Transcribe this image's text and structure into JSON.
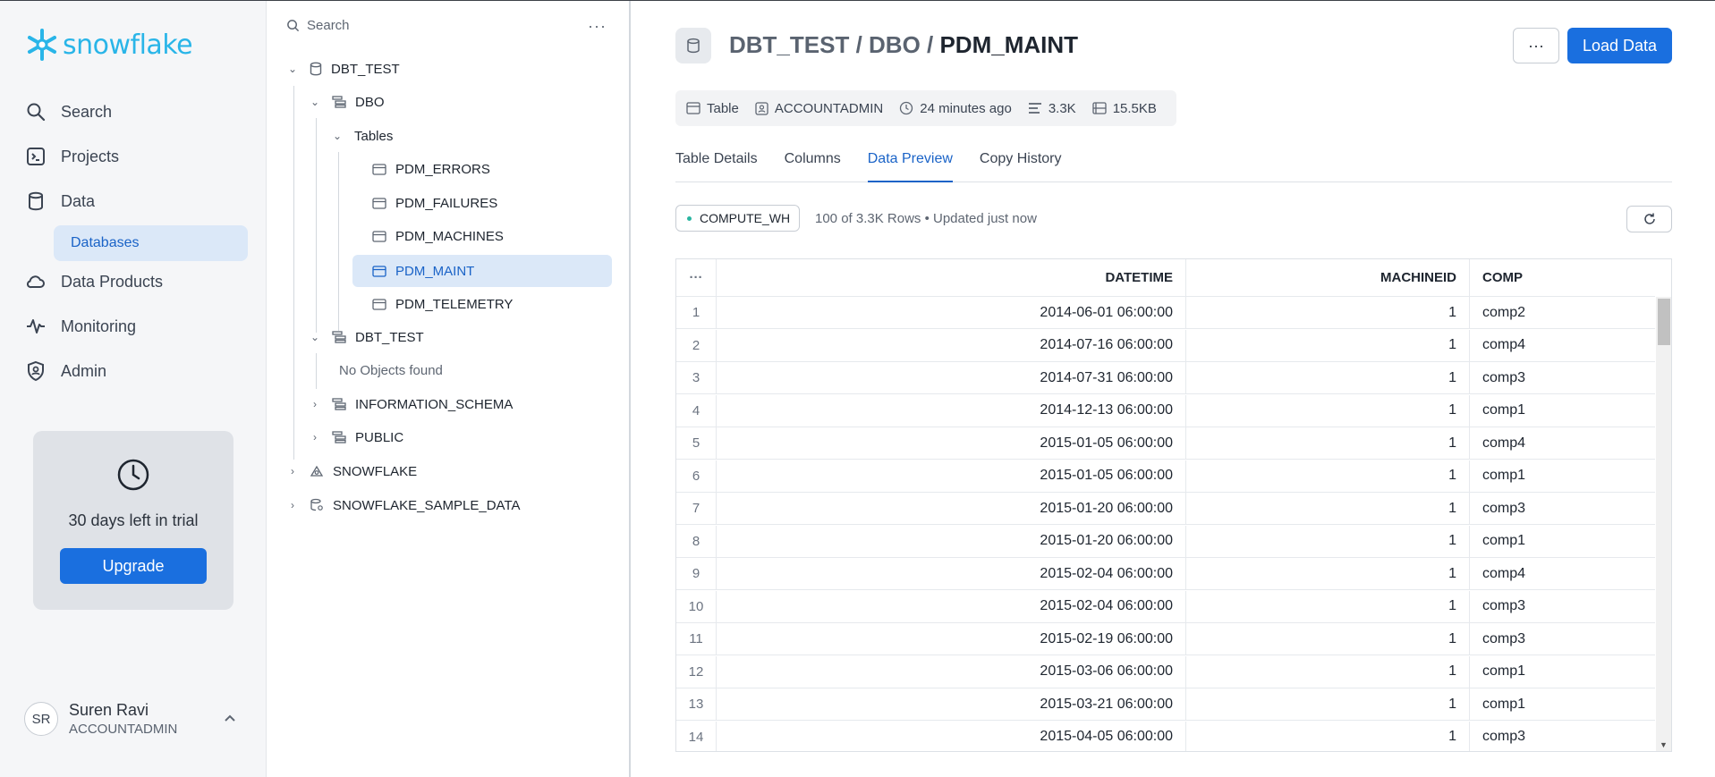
{
  "nav": {
    "logo_text": "snowflake",
    "items": [
      {
        "label": "Search",
        "icon": "search-icon"
      },
      {
        "label": "Projects",
        "icon": "terminal-icon"
      },
      {
        "label": "Data",
        "icon": "database-icon"
      },
      {
        "label": "Data Products",
        "icon": "cloud-icon"
      },
      {
        "label": "Monitoring",
        "icon": "activity-icon"
      },
      {
        "label": "Admin",
        "icon": "shield-icon"
      }
    ],
    "sub_item": "Databases",
    "trial": {
      "text": "30 days left in trial",
      "button": "Upgrade"
    },
    "user": {
      "initials": "SR",
      "name": "Suren Ravi",
      "role": "ACCOUNTADMIN"
    }
  },
  "tree": {
    "search_placeholder": "Search",
    "more": "···",
    "nodes": {
      "db1": "DBT_TEST",
      "schema_dbo": "DBO",
      "tables": "Tables",
      "t1": "PDM_ERRORS",
      "t2": "PDM_FAILURES",
      "t3": "PDM_MACHINES",
      "t4": "PDM_MAINT",
      "t5": "PDM_TELEMETRY",
      "schema_dbt": "DBT_TEST",
      "no_objects": "No Objects found",
      "schema_info": "INFORMATION_SCHEMA",
      "schema_public": "PUBLIC",
      "db2": "SNOWFLAKE",
      "db3": "SNOWFLAKE_SAMPLE_DATA"
    }
  },
  "header": {
    "crumb_db": "DBT_TEST",
    "crumb_schema": "DBO",
    "crumb_table": "PDM_MAINT",
    "sep": " / ",
    "more": "···",
    "load_button": "Load Data"
  },
  "meta": {
    "type": "Table",
    "owner": "ACCOUNTADMIN",
    "updated": "24 minutes ago",
    "rows": "3.3K",
    "size": "15.5KB"
  },
  "tabs": [
    "Table Details",
    "Columns",
    "Data Preview",
    "Copy History"
  ],
  "active_tab": "Data Preview",
  "preview": {
    "warehouse": "COMPUTE_WH",
    "rows_info": "100 of 3.3K Rows • Updated just now",
    "columns": {
      "menu": "···",
      "datetime": "DATETIME",
      "machineid": "MACHINEID",
      "comp": "COMP"
    },
    "rows": [
      [
        "1",
        "2014-06-01 06:00:00",
        "1",
        "comp2"
      ],
      [
        "2",
        "2014-07-16 06:00:00",
        "1",
        "comp4"
      ],
      [
        "3",
        "2014-07-31 06:00:00",
        "1",
        "comp3"
      ],
      [
        "4",
        "2014-12-13 06:00:00",
        "1",
        "comp1"
      ],
      [
        "5",
        "2015-01-05 06:00:00",
        "1",
        "comp4"
      ],
      [
        "6",
        "2015-01-05 06:00:00",
        "1",
        "comp1"
      ],
      [
        "7",
        "2015-01-20 06:00:00",
        "1",
        "comp3"
      ],
      [
        "8",
        "2015-01-20 06:00:00",
        "1",
        "comp1"
      ],
      [
        "9",
        "2015-02-04 06:00:00",
        "1",
        "comp4"
      ],
      [
        "10",
        "2015-02-04 06:00:00",
        "1",
        "comp3"
      ],
      [
        "11",
        "2015-02-19 06:00:00",
        "1",
        "comp3"
      ],
      [
        "12",
        "2015-03-06 06:00:00",
        "1",
        "comp1"
      ],
      [
        "13",
        "2015-03-21 06:00:00",
        "1",
        "comp1"
      ],
      [
        "14",
        "2015-04-05 06:00:00",
        "1",
        "comp3"
      ]
    ]
  }
}
